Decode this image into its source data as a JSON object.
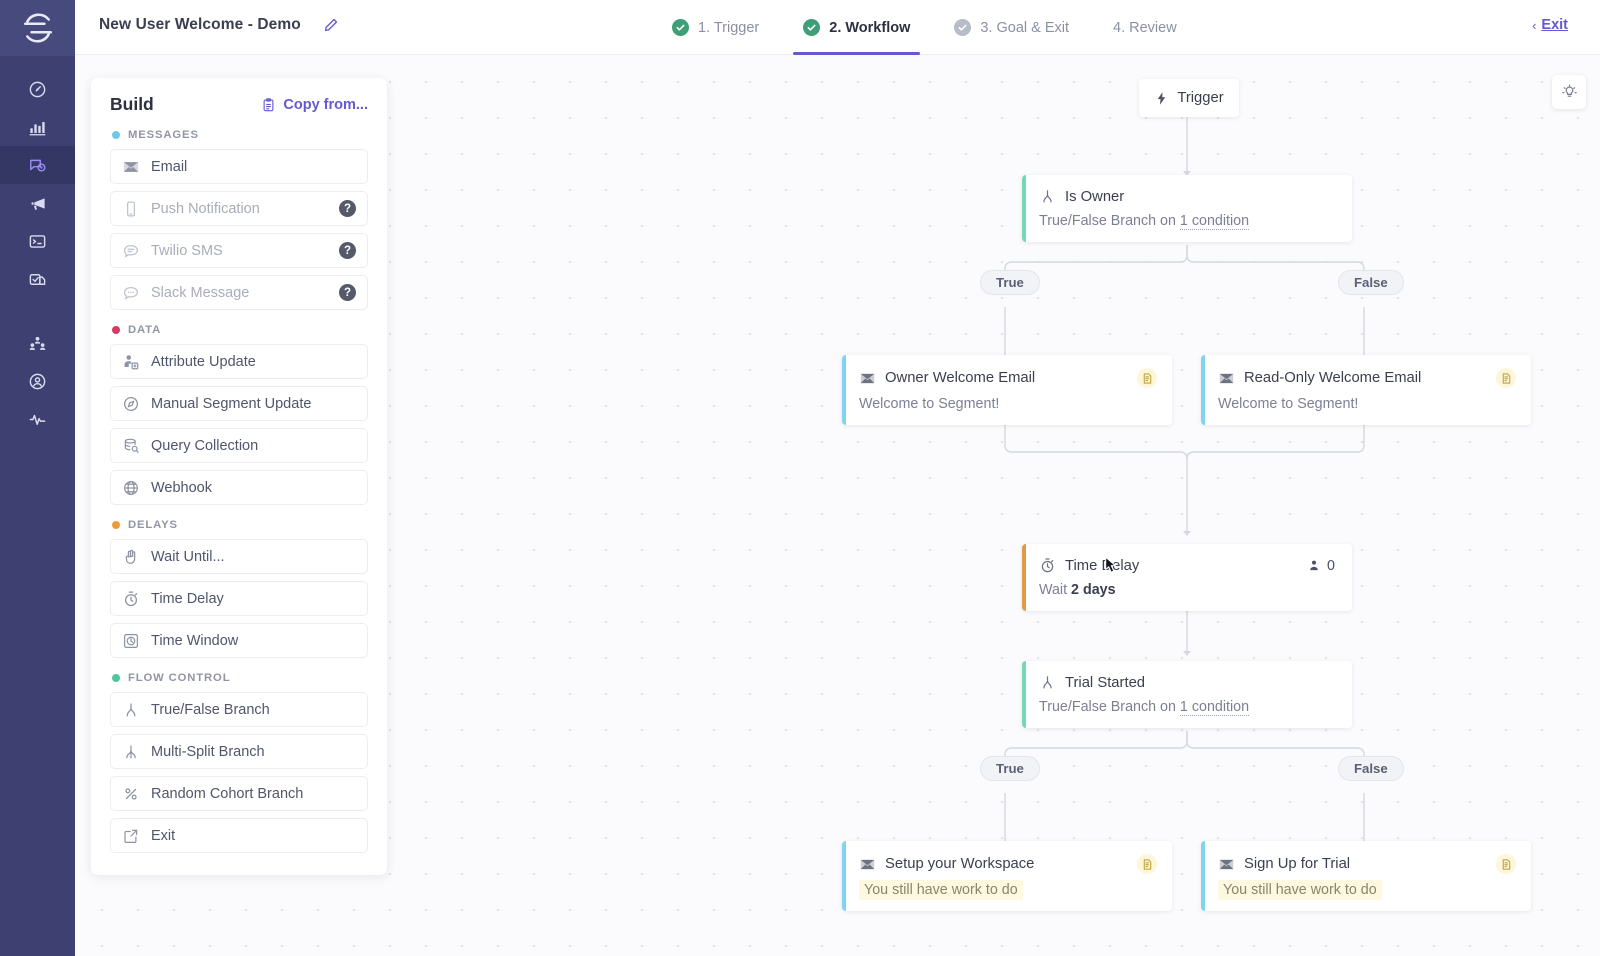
{
  "app": {
    "logo_icon": "segment-logo-icon",
    "document_title": "New User Welcome - Demo",
    "edit_icon": "pencil-icon",
    "exit_chevron": "‹",
    "exit_label": "Exit"
  },
  "rail": {
    "items": [
      {
        "icon": "speedometer-icon",
        "name": "dashboard",
        "active": false
      },
      {
        "icon": "bar-chart-icon",
        "name": "analytics",
        "active": false
      },
      {
        "icon": "journeys-icon",
        "name": "journeys",
        "active": true
      },
      {
        "icon": "megaphone-icon",
        "name": "campaigns",
        "active": false
      },
      {
        "icon": "terminal-icon",
        "name": "developer",
        "active": false
      },
      {
        "icon": "checkbox-truck-icon",
        "name": "tasks",
        "active": false
      },
      {
        "icon": "people-group-icon",
        "name": "audiences",
        "active": false
      },
      {
        "icon": "user-circle-icon",
        "name": "profiles",
        "active": false
      },
      {
        "icon": "activity-pulse-icon",
        "name": "activity",
        "active": false
      }
    ]
  },
  "steps": [
    {
      "label": "1. Trigger",
      "state": "done",
      "check": "check-circle-green-icon"
    },
    {
      "label": "2. Workflow",
      "state": "current",
      "check": "check-circle-green-icon"
    },
    {
      "label": "3. Goal & Exit",
      "state": "todo",
      "check": "check-circle-grey-icon"
    },
    {
      "label": "4. Review",
      "state": "plain",
      "check": "none"
    }
  ],
  "panel": {
    "title": "Build",
    "copy_from_label": "Copy from...",
    "copy_from_icon": "clipboard-icon",
    "groups": [
      {
        "label": "MESSAGES",
        "dot_color": "#6fc8e8",
        "tools": [
          {
            "label": "Email",
            "icon": "envelope-icon",
            "muted": false,
            "help": false
          },
          {
            "label": "Push Notification",
            "icon": "mobile-phone-icon",
            "muted": true,
            "help": true,
            "help_label": "?"
          },
          {
            "label": "Twilio SMS",
            "icon": "sms-bubble-icon",
            "muted": true,
            "help": true,
            "help_label": "?"
          },
          {
            "label": "Slack Message",
            "icon": "chat-bubble-icon",
            "muted": true,
            "help": true,
            "help_label": "?"
          }
        ]
      },
      {
        "label": "DATA",
        "dot_color": "#d63a62",
        "tools": [
          {
            "label": "Attribute Update",
            "icon": "user-attribute-icon",
            "muted": false,
            "help": false
          },
          {
            "label": "Manual Segment Update",
            "icon": "compass-icon",
            "muted": false,
            "help": false
          },
          {
            "label": "Query Collection",
            "icon": "database-search-icon",
            "muted": false,
            "help": false
          },
          {
            "label": "Webhook",
            "icon": "globe-icon",
            "muted": false,
            "help": false
          }
        ]
      },
      {
        "label": "DELAYS",
        "dot_color": "#ef9a36",
        "tools": [
          {
            "label": "Wait Until...",
            "icon": "hand-stop-icon",
            "muted": false,
            "help": false
          },
          {
            "label": "Time Delay",
            "icon": "stopwatch-icon",
            "muted": false,
            "help": false
          },
          {
            "label": "Time Window",
            "icon": "clock-box-icon",
            "muted": false,
            "help": false
          }
        ]
      },
      {
        "label": "FLOW CONTROL",
        "dot_color": "#4ec79a",
        "tools": [
          {
            "label": "True/False Branch",
            "icon": "branch-two-icon",
            "muted": false,
            "help": false
          },
          {
            "label": "Multi-Split Branch",
            "icon": "branch-multi-icon",
            "muted": false,
            "help": false
          },
          {
            "label": "Random Cohort Branch",
            "icon": "percent-icon",
            "muted": false,
            "help": false
          },
          {
            "label": "Exit",
            "icon": "exit-arrow-icon",
            "muted": false,
            "help": false
          }
        ]
      }
    ]
  },
  "canvas": {
    "tips_icon": "lightbulb-icon",
    "nodes": {
      "trigger": {
        "title": "Trigger",
        "icon": "lightning-bolt-icon"
      },
      "is_owner": {
        "title": "Is Owner",
        "icon": "branch-two-icon",
        "accent": "#77d7b0",
        "sub_prefix": "True/False Branch on ",
        "sub_link": "1 condition"
      },
      "owner_email": {
        "title": "Owner Welcome Email",
        "icon": "envelope-icon",
        "accent": "#7fd4ef",
        "sub": "Welcome to Segment!",
        "badge": "draft-document-icon"
      },
      "readonly_email": {
        "title": "Read-Only Welcome Email",
        "icon": "envelope-icon",
        "accent": "#7fd4ef",
        "sub": "Welcome to Segment!",
        "badge": "draft-document-icon"
      },
      "time_delay": {
        "title": "Time Delay",
        "icon": "stopwatch-icon",
        "accent": "#e09a4a",
        "sub_prefix": "Wait ",
        "sub_strong": "2 days",
        "count_icon": "person-icon",
        "count": "0"
      },
      "trial_started": {
        "title": "Trial Started",
        "icon": "branch-two-icon",
        "accent": "#77d7b0",
        "sub_prefix": "True/False Branch on ",
        "sub_link": "1 condition"
      },
      "setup_workspace": {
        "title": "Setup your Workspace",
        "icon": "envelope-icon",
        "accent": "#7fd4ef",
        "sub": "You still have work to do",
        "badge": "draft-document-icon"
      },
      "signup_trial": {
        "title": "Sign Up for Trial",
        "icon": "envelope-icon",
        "accent": "#7fd4ef",
        "sub": "You still have work to do",
        "badge": "draft-document-icon"
      }
    },
    "pills": {
      "owner_true": "True",
      "owner_false": "False",
      "trial_true": "True",
      "trial_false": "False"
    }
  }
}
